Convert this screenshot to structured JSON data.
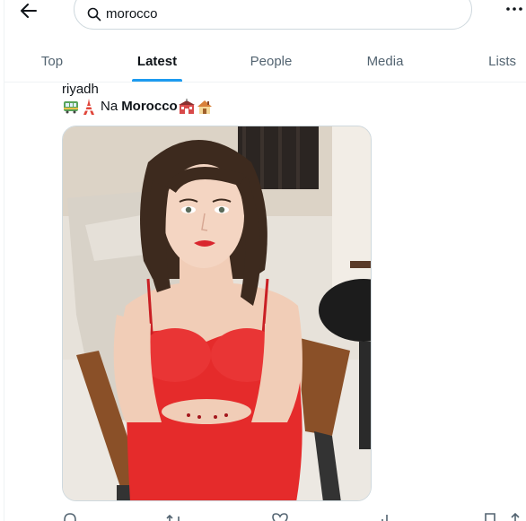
{
  "search": {
    "query": "morocco"
  },
  "tabs": [
    {
      "label": "Top",
      "active": false
    },
    {
      "label": "Latest",
      "active": true
    },
    {
      "label": "People",
      "active": false
    },
    {
      "label": "Media",
      "active": false
    },
    {
      "label": "Lists",
      "active": false
    }
  ],
  "tweet": {
    "text_line1": "riyadh",
    "text_prefix": "Na",
    "text_highlight": "Morocco",
    "emojis_before": [
      "train-emoji",
      "tokyo-tower-emoji"
    ],
    "emojis_after": [
      "school-emoji",
      "house-emoji"
    ],
    "media_alt": "photo"
  },
  "icons": {
    "back": "arrow-left-icon",
    "search": "search-icon",
    "more": "more-horizontal-icon",
    "reply": "reply-icon",
    "retweet": "retweet-icon",
    "like": "heart-icon",
    "views": "views-icon",
    "bookmark": "bookmark-icon",
    "share": "share-icon"
  },
  "colors": {
    "accent": "#1d9bf0",
    "text_primary": "#0f1419",
    "text_secondary": "#536471",
    "border": "#cfd9de",
    "dress_red": "#e52b2b"
  }
}
